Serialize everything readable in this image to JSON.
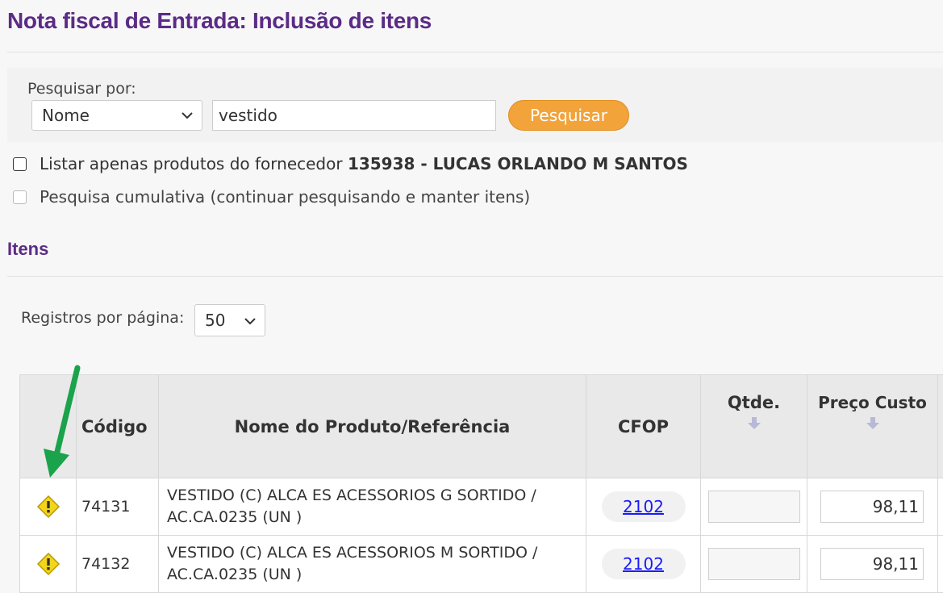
{
  "page_title": "Nota fiscal de Entrada: Inclusão de itens",
  "search": {
    "label": "Pesquisar por:",
    "field_select": "Nome",
    "query": "vestido",
    "button_label": "Pesquisar"
  },
  "filters": {
    "supplier_only_label": "Listar apenas produtos do fornecedor",
    "supplier_name": "135938 - LUCAS ORLANDO M SANTOS",
    "cumulative_label": "Pesquisa cumulativa (continuar pesquisando e manter itens)"
  },
  "items_section": {
    "title": "Itens",
    "per_page_label": "Registros por página:",
    "per_page_value": "50"
  },
  "table": {
    "headers": {
      "code": "Código",
      "name": "Nome do Produto/Referência",
      "cfop": "CFOP",
      "qty": "Qtde.",
      "price": "Preço Custo"
    },
    "rows": [
      {
        "code": "74131",
        "name_line1": "VESTIDO (C) ALCA ES ACESSORIOS G SORTIDO /",
        "name_line2": "AC.CA.0235 (UN )",
        "cfop": "2102",
        "qty": "",
        "price": "98,11"
      },
      {
        "code": "74132",
        "name_line1": "VESTIDO (C) ALCA ES ACESSORIOS M SORTIDO /",
        "name_line2": "AC.CA.0235 (UN )",
        "cfop": "2102",
        "qty": "",
        "price": "98,11"
      }
    ]
  },
  "colors": {
    "title_purple": "#5b2b86",
    "button_orange": "#f2a33a",
    "arrow_green": "#1aa34a",
    "warning_yellow": "#f3d51c"
  },
  "icons": [
    "chevron-down-icon",
    "warning-icon",
    "sort-down-icon",
    "arrow-annotation-icon"
  ]
}
